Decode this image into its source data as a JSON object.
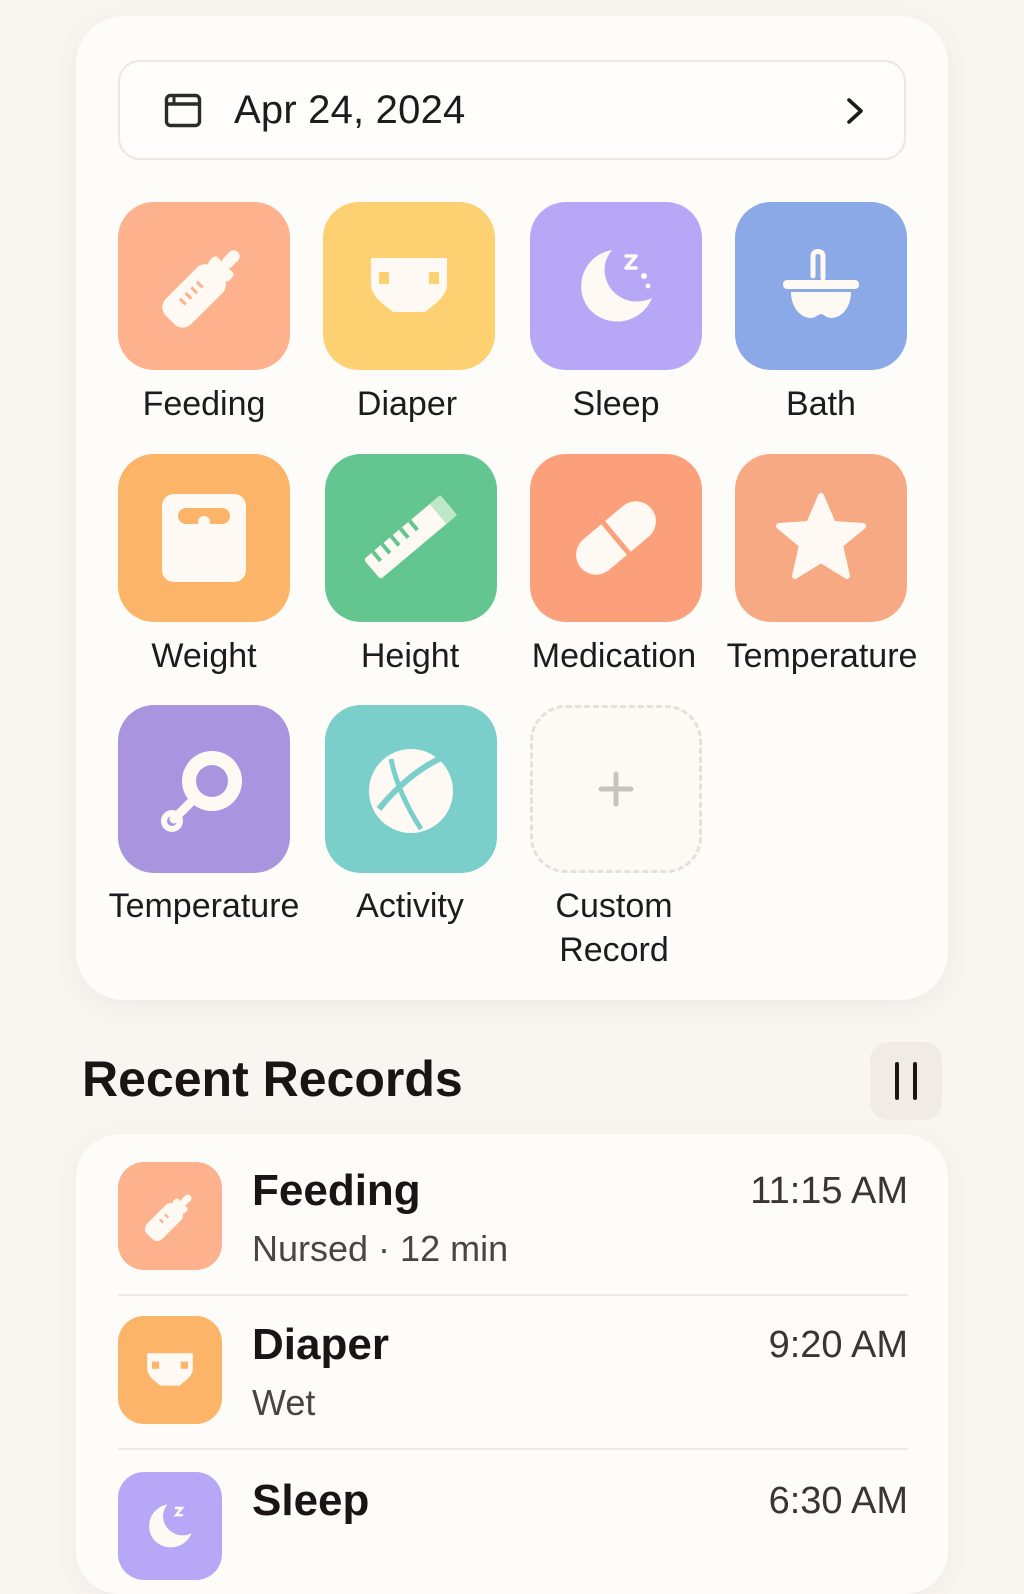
{
  "date_bar": {
    "date": "Apr 24, 2024",
    "calendar_icon": "calendar-icon",
    "next_icon": "chevron-right-icon"
  },
  "tiles": [
    {
      "label": "Feeding",
      "icon": "baby-bottle-icon",
      "color": "#fdb18c"
    },
    {
      "label": "Diaper",
      "icon": "diaper-icon",
      "color": "#fdd072"
    },
    {
      "label": "Sleep",
      "icon": "moon-icon",
      "color": "#b6a8f7"
    },
    {
      "label": "Bath",
      "icon": "bathtub-icon",
      "color": "#8aa9e6"
    },
    {
      "label": "Weight",
      "icon": "scale-icon",
      "color": "#fcb468"
    },
    {
      "label": "Height",
      "icon": "ruler-icon",
      "color": "#63c690"
    },
    {
      "label": "Medication",
      "icon": "pill-icon",
      "color": "#fca07c"
    },
    {
      "label": "Temperature",
      "icon": "star-icon",
      "color": "#f6a982"
    },
    {
      "label": "Temperature",
      "icon": "rattle-icon",
      "color": "#a994e0"
    },
    {
      "label": "Activity",
      "icon": "ball-icon",
      "color": "#7bcfca"
    },
    {
      "label": "Custom\nRecord",
      "icon": "plus-icon",
      "color": "#fdfaf6"
    }
  ],
  "recent": {
    "title": "Recent Records",
    "pause_icon": "pause-icon",
    "items": [
      {
        "title": "Feeding",
        "subtitle": "Nursed · 12 min",
        "time": "11:15 AM",
        "icon": "baby-bottle-icon",
        "color": "#fdb18c"
      },
      {
        "title": "Diaper",
        "subtitle": "Wet",
        "time": "9:20 AM",
        "icon": "diaper-icon",
        "color": "#fcb468"
      },
      {
        "title": "Sleep",
        "subtitle": "",
        "time": "6:30 AM",
        "icon": "moon-icon",
        "color": "#b6a8f7"
      }
    ]
  }
}
